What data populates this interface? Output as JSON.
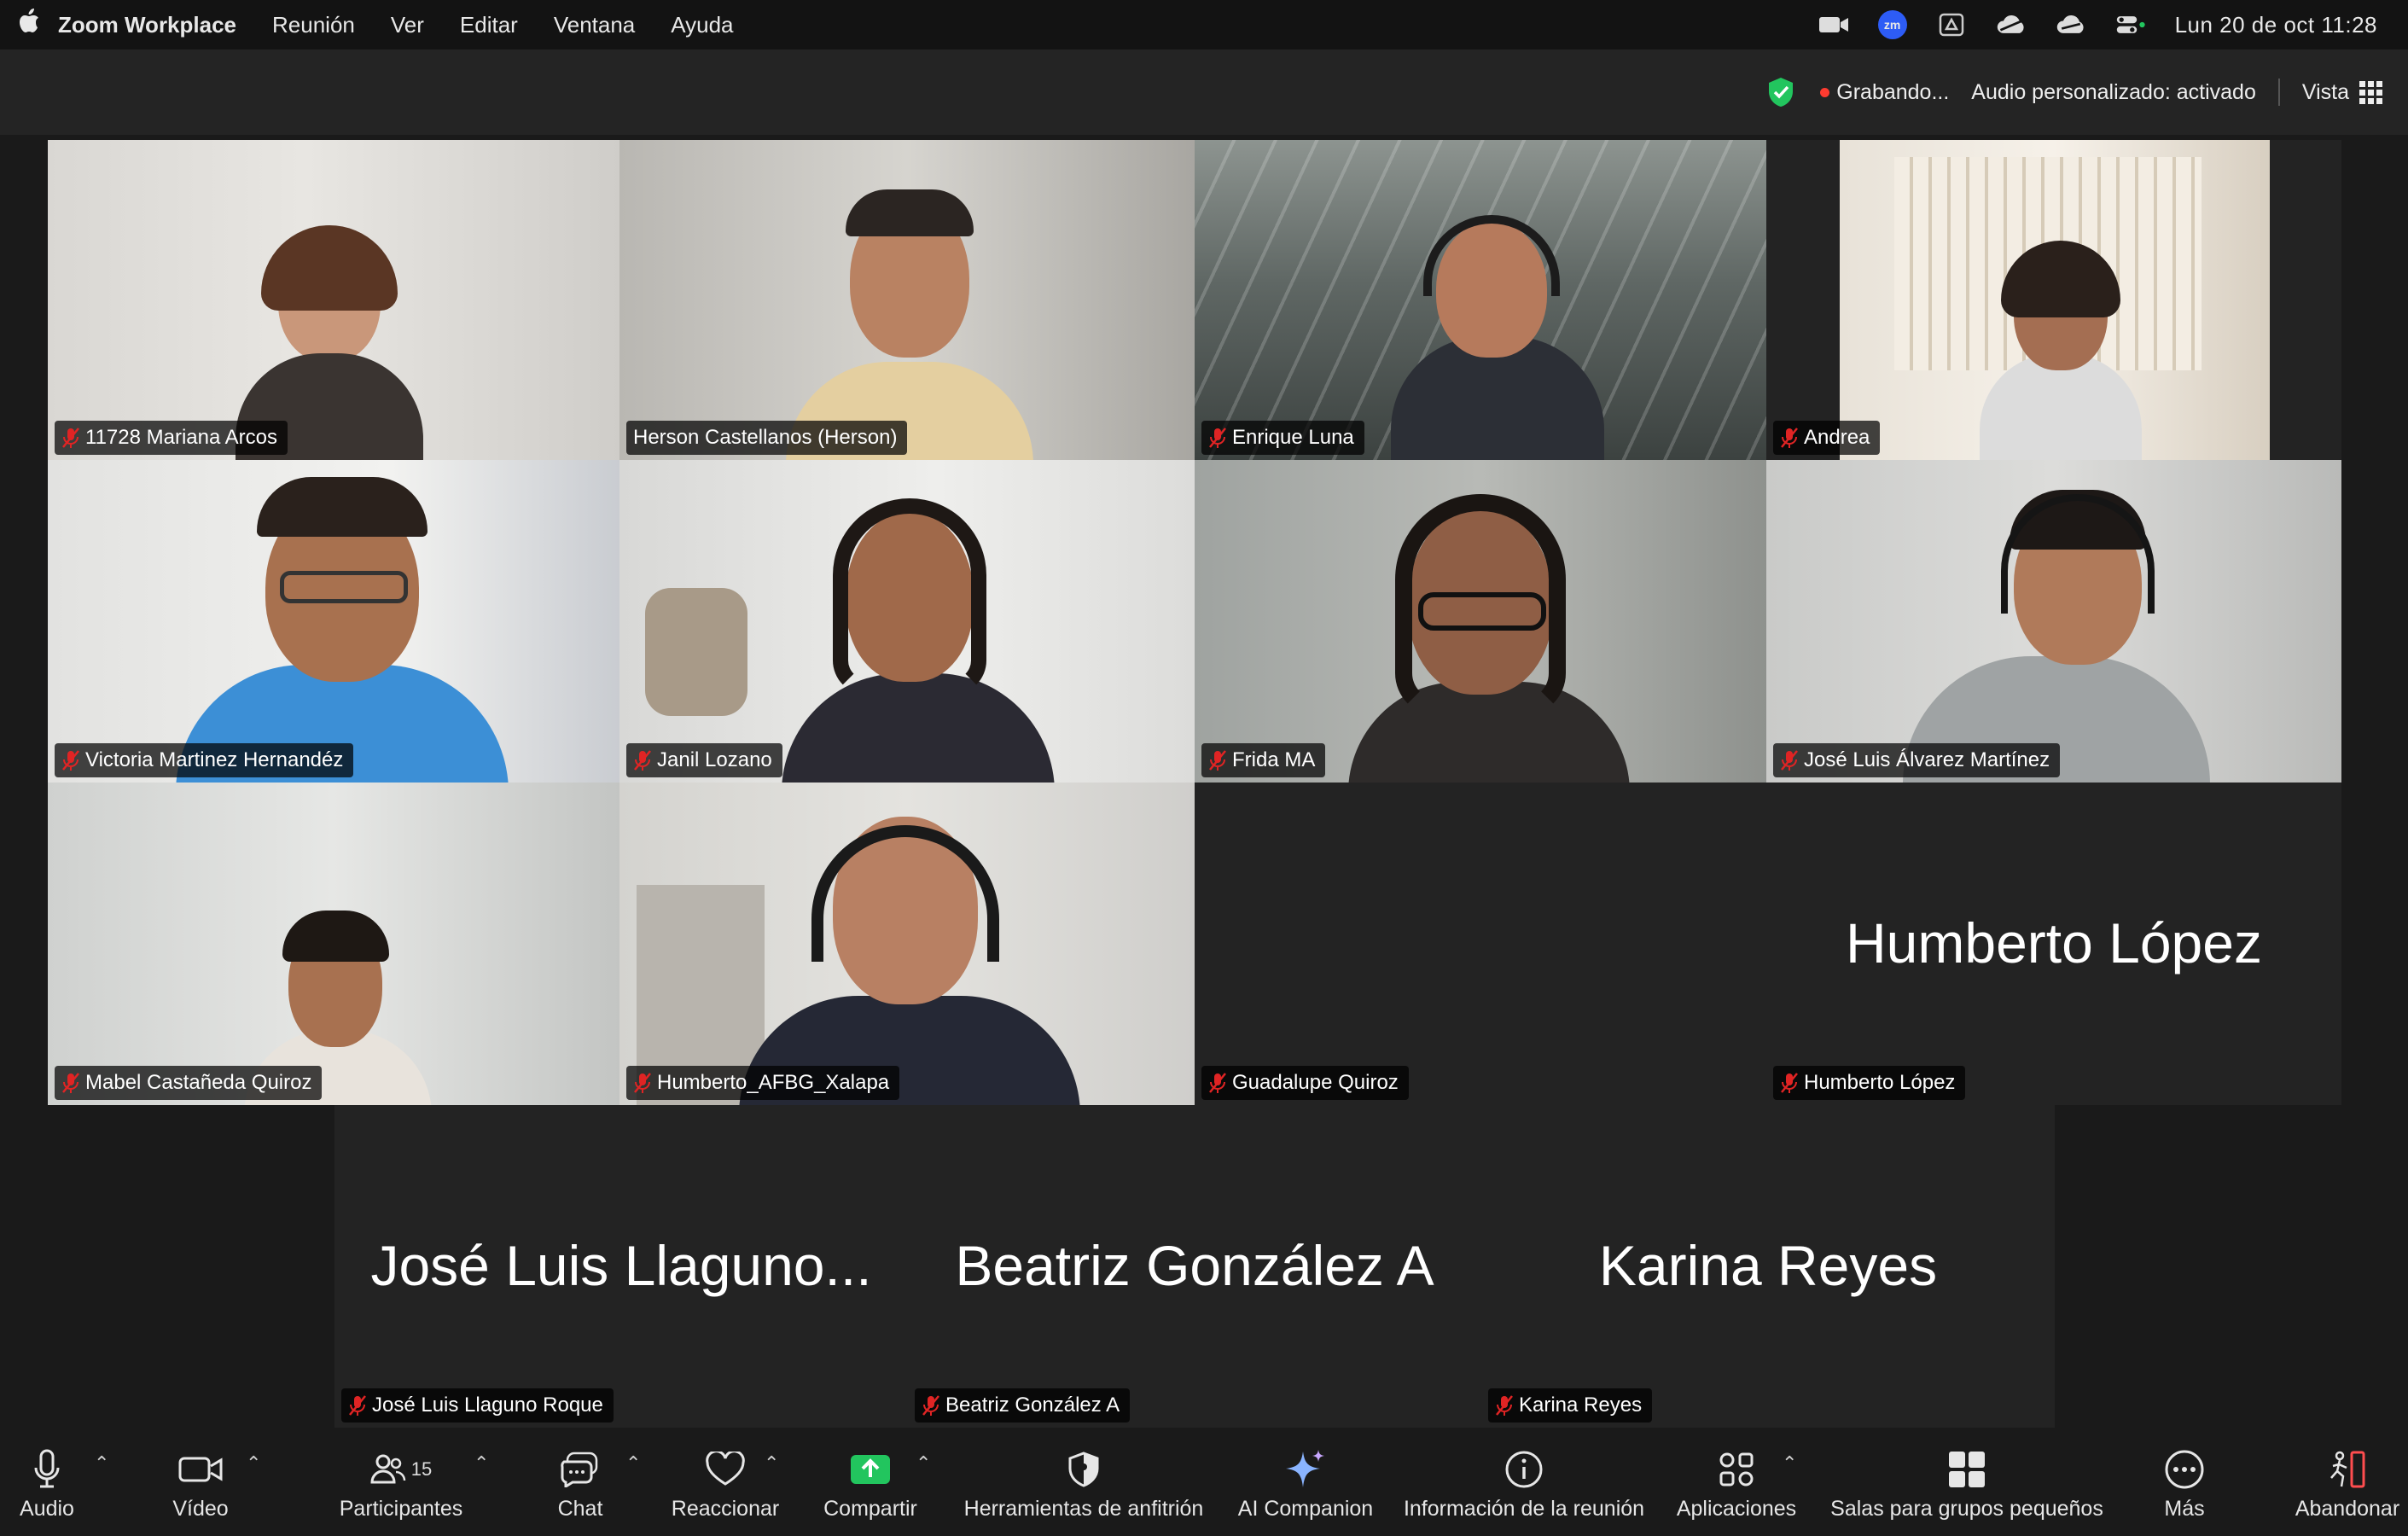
{
  "menubar": {
    "app_name": "Zoom Workplace",
    "menus": [
      "Reunión",
      "Ver",
      "Editar",
      "Ventana",
      "Ayuda"
    ],
    "zm_badge": "zm",
    "clock": "Lun 20 de oct  11:28"
  },
  "topbar": {
    "recording": "Grabando...",
    "audio": "Audio personalizado: activado",
    "view": "Vista"
  },
  "participants": [
    {
      "name": "11728 Mariana Arcos",
      "muted": true
    },
    {
      "name": "Herson Castellanos (Herson)",
      "muted": false,
      "active_speaker": true
    },
    {
      "name": "Enrique Luna",
      "muted": true
    },
    {
      "name": "Andrea",
      "muted": true
    },
    {
      "name": "Victoria Martinez Hernandéz",
      "muted": true
    },
    {
      "name": "Janil Lozano",
      "muted": true
    },
    {
      "name": "Frida MA",
      "muted": true
    },
    {
      "name": "José Luis Álvarez Martínez",
      "muted": true
    },
    {
      "name": "Mabel Castañeda Quiroz",
      "muted": true
    },
    {
      "name": "Humberto_AFBG_Xalapa",
      "muted": true
    },
    {
      "name": "Guadalupe Quiroz",
      "muted": true
    },
    {
      "name": "Humberto López",
      "muted": true,
      "big_name": "Humberto López"
    },
    {
      "name": "José Luis Llaguno Roque",
      "muted": true,
      "big_name": "José Luis Llaguno..."
    },
    {
      "name": "Beatriz González A",
      "muted": true,
      "big_name": "Beatriz González A"
    },
    {
      "name": "Karina Reyes",
      "muted": true,
      "big_name": "Karina Reyes"
    }
  ],
  "toolbar": {
    "audio": "Audio",
    "video": "Vídeo",
    "participants": "Participantes",
    "participants_count": "15",
    "chat": "Chat",
    "react": "Reaccionar",
    "share": "Compartir",
    "host_tools": "Herramientas de anfitrión",
    "ai_companion": "AI Companion",
    "meeting_info": "Información de la reunión",
    "apps": "Aplicaciones",
    "breakout": "Salas para grupos pequeños",
    "more": "Más",
    "leave": "Abandonar"
  },
  "colors": {
    "active_speaker_border": "#3fd14a",
    "share_green": "#22c55e",
    "leave_red": "#ff4d4f",
    "recording_red": "#ff3b30",
    "shield_green": "#22c55e"
  }
}
